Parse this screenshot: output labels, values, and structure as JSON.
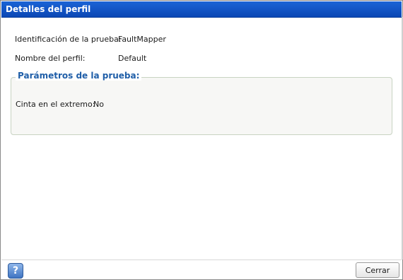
{
  "window": {
    "title": "Detalles del perfil"
  },
  "details": {
    "test_id_label": "Identificación de la prueba:",
    "test_id_value": "FaultMapper",
    "profile_name_label": "Nombre del perfil:",
    "profile_name_value": "Default"
  },
  "parameters": {
    "legend": "Parámetros de la prueba:",
    "tape_label": "Cinta en el extremo:",
    "tape_value": "No"
  },
  "footer": {
    "help_icon": "question-mark-icon",
    "help_glyph": "?",
    "close_label": "Cerrar"
  }
}
